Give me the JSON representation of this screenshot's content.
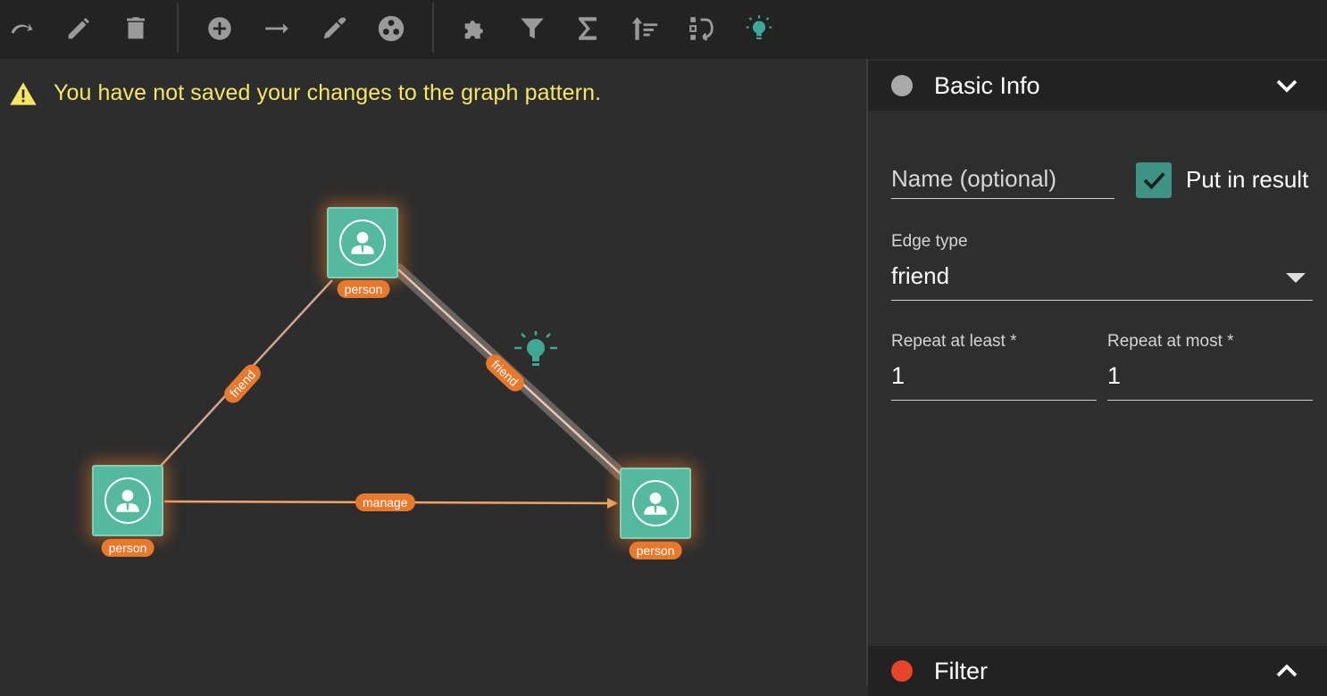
{
  "toolbar": {
    "buttons": [
      {
        "name": "redo-icon",
        "active": false
      },
      {
        "name": "edit-icon",
        "active": false
      },
      {
        "name": "delete-icon",
        "active": false
      },
      {
        "name": "add-node-icon",
        "active": false
      },
      {
        "name": "add-edge-icon",
        "active": false
      },
      {
        "name": "eyedropper-icon",
        "active": false
      },
      {
        "name": "cluster-icon",
        "active": false
      },
      {
        "name": "puzzle-icon",
        "active": false
      },
      {
        "name": "filter-icon",
        "active": false
      },
      {
        "name": "sigma-icon",
        "active": false
      },
      {
        "name": "sort-icon",
        "active": false
      },
      {
        "name": "rearrange-icon",
        "active": false
      },
      {
        "name": "lightbulb-icon",
        "active": true
      }
    ],
    "icon_color": "#9a9a9a",
    "active_color": "#3fa895"
  },
  "warning": {
    "text": "You have not saved your changes to the graph pattern.",
    "color": "#f5e663"
  },
  "graph": {
    "node_color": "#55b9a0",
    "label_color": "#e8782c",
    "nodes": [
      {
        "id": "top",
        "label": "person"
      },
      {
        "id": "left",
        "label": "person"
      },
      {
        "id": "right",
        "label": "person"
      }
    ],
    "edges": [
      {
        "from": "top",
        "to": "left",
        "label": "friend"
      },
      {
        "from": "top",
        "to": "right",
        "label": "friend",
        "selected": true
      },
      {
        "from": "left",
        "to": "right",
        "label": "manage"
      }
    ]
  },
  "panel": {
    "basic_info": {
      "title": "Basic Info",
      "dot_color": "#aaaaaa",
      "name_placeholder": "Name (optional)",
      "name_value": "",
      "put_in_result_label": "Put in result",
      "put_in_result_checked": true,
      "edge_type_label": "Edge type",
      "edge_type_value": "friend",
      "repeat_least_label": "Repeat at least *",
      "repeat_least_value": "1",
      "repeat_most_label": "Repeat at most *",
      "repeat_most_value": "1"
    },
    "filter": {
      "title": "Filter",
      "dot_color": "#e8452c"
    }
  }
}
